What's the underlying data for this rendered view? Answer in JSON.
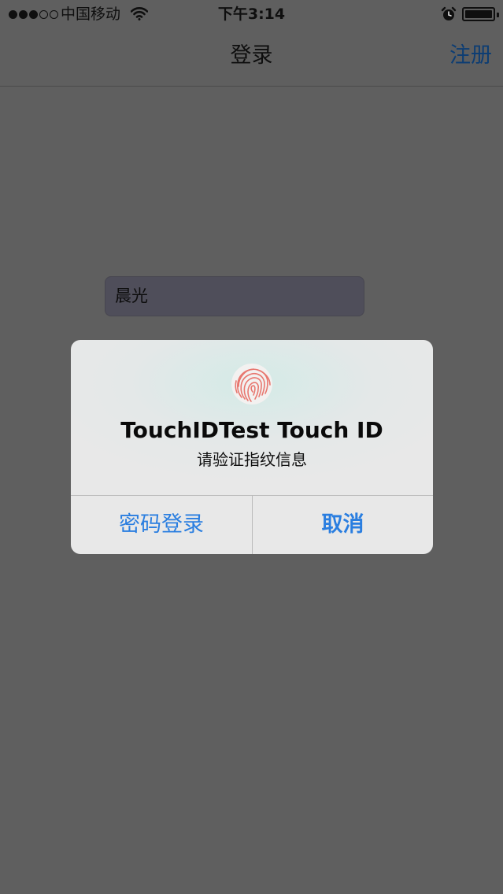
{
  "status_bar": {
    "signal_strength_filled": 3,
    "signal_strength_total": 5,
    "carrier": "中国移动",
    "wifi_icon": "wifi-icon",
    "time": "下午3:14",
    "alarm_icon": "alarm-clock-icon",
    "battery_icon": "battery-icon",
    "battery_level": 1.0
  },
  "nav": {
    "title": "登录",
    "right_button": "注册"
  },
  "form": {
    "username_value": "晨光"
  },
  "alert": {
    "icon": "fingerprint-icon",
    "title": "TouchIDTest Touch ID",
    "message": "请验证指纹信息",
    "fallback_button": "密码登录",
    "cancel_button": "取消"
  },
  "colors": {
    "dim_background": "#5f5f5f",
    "accent_blue": "#2a7ee0",
    "nav_button_dimmed": "#0d3d73",
    "fingerprint_red": "#e8776f"
  }
}
